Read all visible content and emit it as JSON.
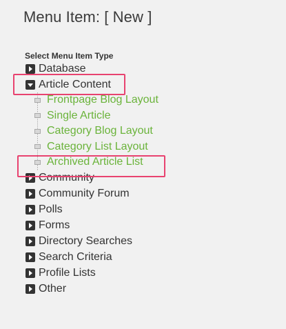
{
  "page": {
    "title": "Menu Item: [ New ]",
    "section_label": "Select Menu Item Type"
  },
  "tree": {
    "items": [
      {
        "label": "Database",
        "expanded": false
      },
      {
        "label": "Article Content",
        "expanded": true,
        "children": [
          {
            "label": "Frontpage Blog Layout"
          },
          {
            "label": "Single Article"
          },
          {
            "label": "Category Blog Layout"
          },
          {
            "label": "Category List Layout"
          },
          {
            "label": "Archived Article List"
          }
        ]
      },
      {
        "label": "Community",
        "expanded": false
      },
      {
        "label": "Community Forum",
        "expanded": false
      },
      {
        "label": "Polls",
        "expanded": false
      },
      {
        "label": "Forms",
        "expanded": false
      },
      {
        "label": "Directory Searches",
        "expanded": false
      },
      {
        "label": "Search Criteria",
        "expanded": false
      },
      {
        "label": "Profile Lists",
        "expanded": false
      },
      {
        "label": "Other",
        "expanded": false
      }
    ]
  },
  "colors": {
    "background": "#f1f1f1",
    "text": "#333333",
    "link": "#6ab33a",
    "highlight": "#e8426f"
  }
}
